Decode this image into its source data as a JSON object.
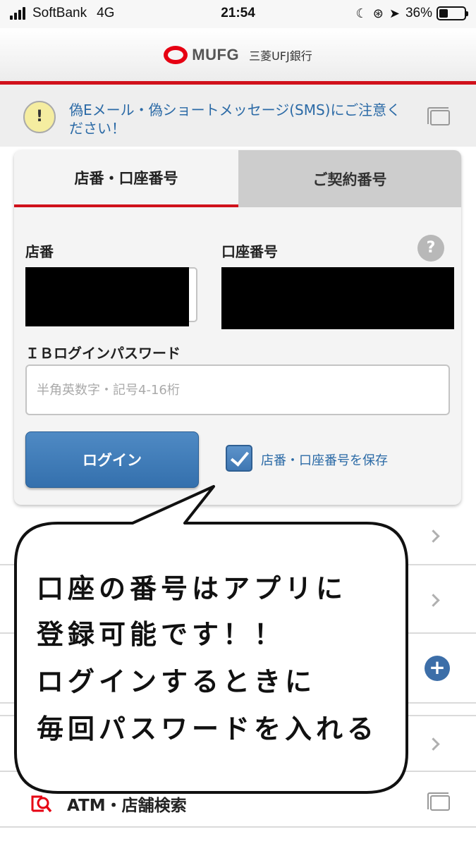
{
  "status_bar": {
    "carrier": "SoftBank",
    "network": "4G",
    "time": "21:54",
    "battery": "36%",
    "battery_level": 0.36
  },
  "header": {
    "brand": "MUFG",
    "bank_name": "三菱UFJ銀行"
  },
  "notice": {
    "icon": "!",
    "text": "偽Eメール・偽ショートメッセージ(SMS)にご注意ください！"
  },
  "login": {
    "tabs": [
      {
        "label": "店番・口座番号",
        "active": true
      },
      {
        "label": "ご契約番号",
        "active": false
      }
    ],
    "branch_label": "店番",
    "account_label": "口座番号",
    "help_icon": "?",
    "password_label": "ＩＢログインパスワード",
    "password_placeholder": "半角英数字・記号4-16桁",
    "login_button": "ログイン",
    "save_checkbox_label": "店番・口座番号を保存",
    "save_checked": true
  },
  "list": {
    "plus_icon": "+",
    "atm_label": "ATM・店舗検索"
  },
  "callout": {
    "lines": [
      "口座の番号はアプリに",
      "登録可能です！！",
      "ログインするときに",
      "毎回パスワードを入れる"
    ]
  },
  "colors": {
    "accent_red": "#d0111b",
    "link_blue": "#2b6aa6",
    "button_blue": "#3c77b3"
  }
}
